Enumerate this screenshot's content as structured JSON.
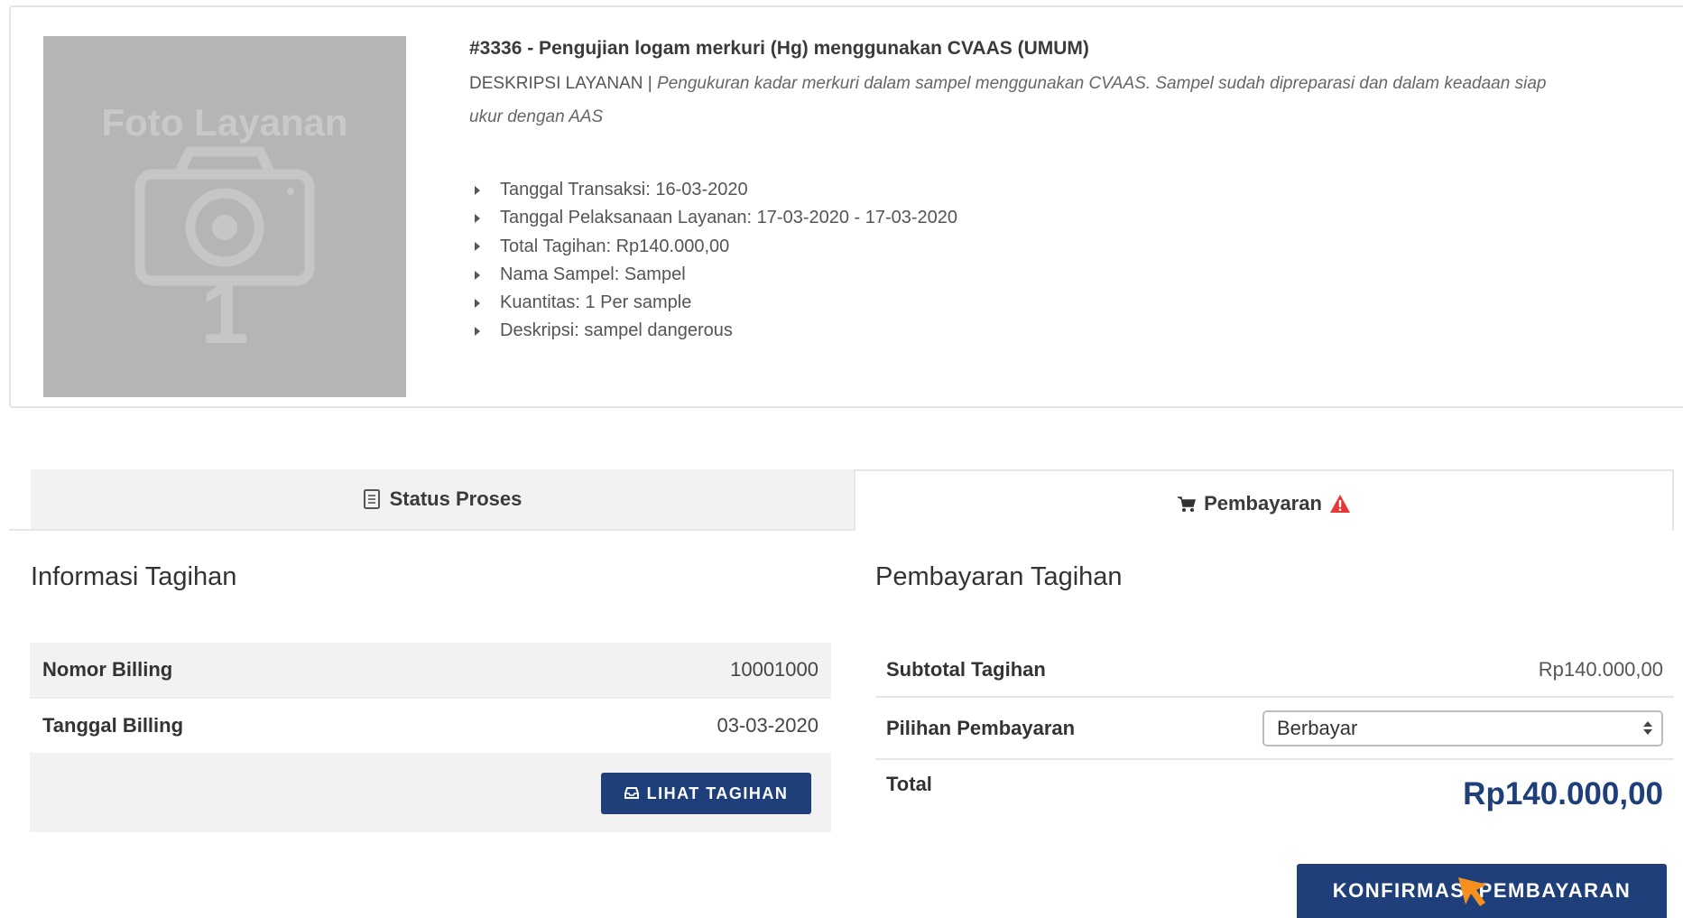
{
  "service": {
    "photo_label": "Foto Layanan",
    "photo_number": "1",
    "title": "#3336 - Pengujian logam merkuri (Hg) menggunakan CVAAS (UMUM)",
    "description_prefix": "DESKRIPSI LAYANAN | ",
    "description_text": "Pengukuran kadar merkuri dalam sampel menggunakan CVAAS. Sampel sudah dipreparasi dan dalam keadaan siap ukur dengan AAS",
    "details": [
      "Tanggal Transaksi: 16-03-2020",
      "Tanggal Pelaksanaan Layanan: 17-03-2020 - 17-03-2020",
      "Total Tagihan: Rp140.000,00",
      "Nama Sampel: Sampel",
      "Kuantitas: 1 Per sample",
      "Deskripsi: sampel dangerous"
    ]
  },
  "tabs": {
    "status_label": "Status Proses",
    "payment_label": "Pembayaran"
  },
  "billing_info": {
    "heading": "Informasi Tagihan",
    "rows": [
      {
        "label": "Nomor Billing",
        "value": "10001000"
      },
      {
        "label": "Tanggal Billing",
        "value": "03-03-2020"
      }
    ],
    "view_button_label": "LIHAT TAGIHAN"
  },
  "payment": {
    "heading": "Pembayaran Tagihan",
    "subtotal_label": "Subtotal Tagihan",
    "subtotal_value": "Rp140.000,00",
    "option_label": "Pilihan Pembayaran",
    "option_selected": "Berbayar",
    "total_label": "Total",
    "total_value": "Rp140.000,00",
    "confirm_button_label": "KONFIRMASI PEMBAYARAN"
  },
  "colors": {
    "primary": "#1f3f7a",
    "warning": "#e53935",
    "cursor": "#f5901e"
  }
}
